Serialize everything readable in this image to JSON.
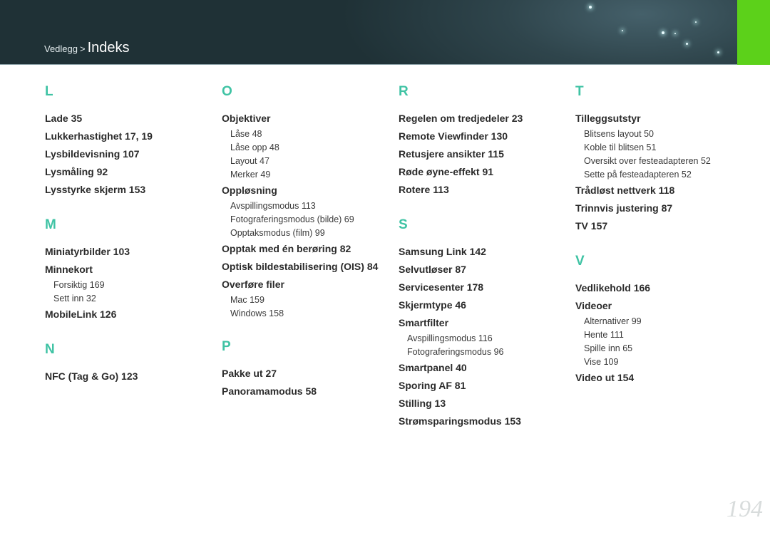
{
  "header": {
    "breadcrumb_parent": "Vedlegg",
    "breadcrumb_sep": ">",
    "title": "Indeks"
  },
  "columns": [
    {
      "sections": [
        {
          "letter": "L",
          "entries": [
            {
              "text": "Lade  35"
            },
            {
              "text": "Lukkerhastighet  17, 19"
            },
            {
              "text": "Lysbildevisning  107"
            },
            {
              "text": "Lysmåling  92"
            },
            {
              "text": "Lysstyrke skjerm  153"
            }
          ]
        },
        {
          "letter": "M",
          "entries": [
            {
              "text": "Miniatyrbilder  103"
            },
            {
              "text": "Minnekort",
              "subs": [
                "Forsiktig  169",
                "Sett inn  32"
              ]
            },
            {
              "text": "MobileLink  126"
            }
          ]
        },
        {
          "letter": "N",
          "entries": [
            {
              "text": "NFC (Tag & Go)  123"
            }
          ]
        }
      ]
    },
    {
      "sections": [
        {
          "letter": "O",
          "entries": [
            {
              "text": "Objektiver",
              "subs": [
                "Låse  48",
                "Låse opp  48",
                "Layout  47",
                "Merker  49"
              ]
            },
            {
              "text": "Oppløsning",
              "subs": [
                "Avspillingsmodus  113",
                "Fotograferingsmodus (bilde)  69",
                "Opptaksmodus (film)  99"
              ]
            },
            {
              "text": "Opptak med én berøring  82"
            },
            {
              "text": "Optisk bildestabilisering (OIS)  84"
            },
            {
              "text": "Overføre filer",
              "subs": [
                "Mac  159",
                "Windows  158"
              ]
            }
          ]
        },
        {
          "letter": "P",
          "entries": [
            {
              "text": "Pakke ut  27"
            },
            {
              "text": "Panoramamodus  58"
            }
          ]
        }
      ]
    },
    {
      "sections": [
        {
          "letter": "R",
          "entries": [
            {
              "text": "Regelen om tredjedeler  23"
            },
            {
              "text": "Remote Viewfinder  130"
            },
            {
              "text": "Retusjere ansikter  115"
            },
            {
              "text": "Røde øyne-effekt  91"
            },
            {
              "text": "Rotere  113"
            }
          ]
        },
        {
          "letter": "S",
          "entries": [
            {
              "text": "Samsung Link  142"
            },
            {
              "text": "Selvutløser  87"
            },
            {
              "text": "Servicesenter  178"
            },
            {
              "text": "Skjermtype  46"
            },
            {
              "text": "Smartfilter",
              "subs": [
                "Avspillingsmodus  116",
                "Fotograferingsmodus  96"
              ]
            },
            {
              "text": "Smartpanel  40"
            },
            {
              "text": "Sporing AF  81"
            },
            {
              "text": "Stilling  13"
            },
            {
              "text": "Strømsparingsmodus  153"
            }
          ]
        }
      ]
    },
    {
      "sections": [
        {
          "letter": "T",
          "entries": [
            {
              "text": "Tilleggsutstyr",
              "subs": [
                "Blitsens layout  50",
                "Koble til blitsen  51",
                "Oversikt over festeadapteren  52",
                "Sette på festeadapteren  52"
              ]
            },
            {
              "text": "Trådløst nettverk  118"
            },
            {
              "text": "Trinnvis justering  87"
            },
            {
              "text": "TV  157"
            }
          ]
        },
        {
          "letter": "V",
          "entries": [
            {
              "text": "Vedlikehold  166"
            },
            {
              "text": "Videoer",
              "subs": [
                "Alternativer  99",
                "Hente  111",
                "Spille inn  65",
                "Vise  109"
              ]
            },
            {
              "text": "Video ut  154"
            }
          ]
        }
      ]
    }
  ],
  "page_number": "194",
  "colors": {
    "accent": "#3fc3a4",
    "tab": "#5cd11a",
    "header": "#2f454c"
  }
}
